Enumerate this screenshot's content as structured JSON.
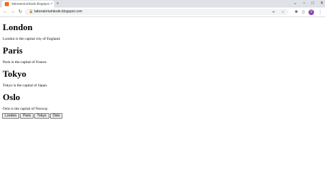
{
  "browser": {
    "tab_title": "laboratoriumkode.blogspot.c",
    "tab_close": "×",
    "new_tab": "+",
    "url": "laboratoriumkode.blogspot.com",
    "profile_initial": "Y"
  },
  "page": {
    "cities": [
      {
        "name": "London",
        "desc": "London is the capital city of England."
      },
      {
        "name": "Paris",
        "desc": "Paris is the capital of France."
      },
      {
        "name": "Tokyo",
        "desc": "Tokyo is the capital of Japan."
      },
      {
        "name": "Oslo",
        "desc": "Oslo is the capital of Norway."
      }
    ],
    "buttons": [
      "London",
      "Paris",
      "Tokyo",
      "Oslo"
    ]
  },
  "colors": {
    "tabstrip": "#dee1e6",
    "favicon": "#f26b1d",
    "profile": "#8e44ad"
  }
}
